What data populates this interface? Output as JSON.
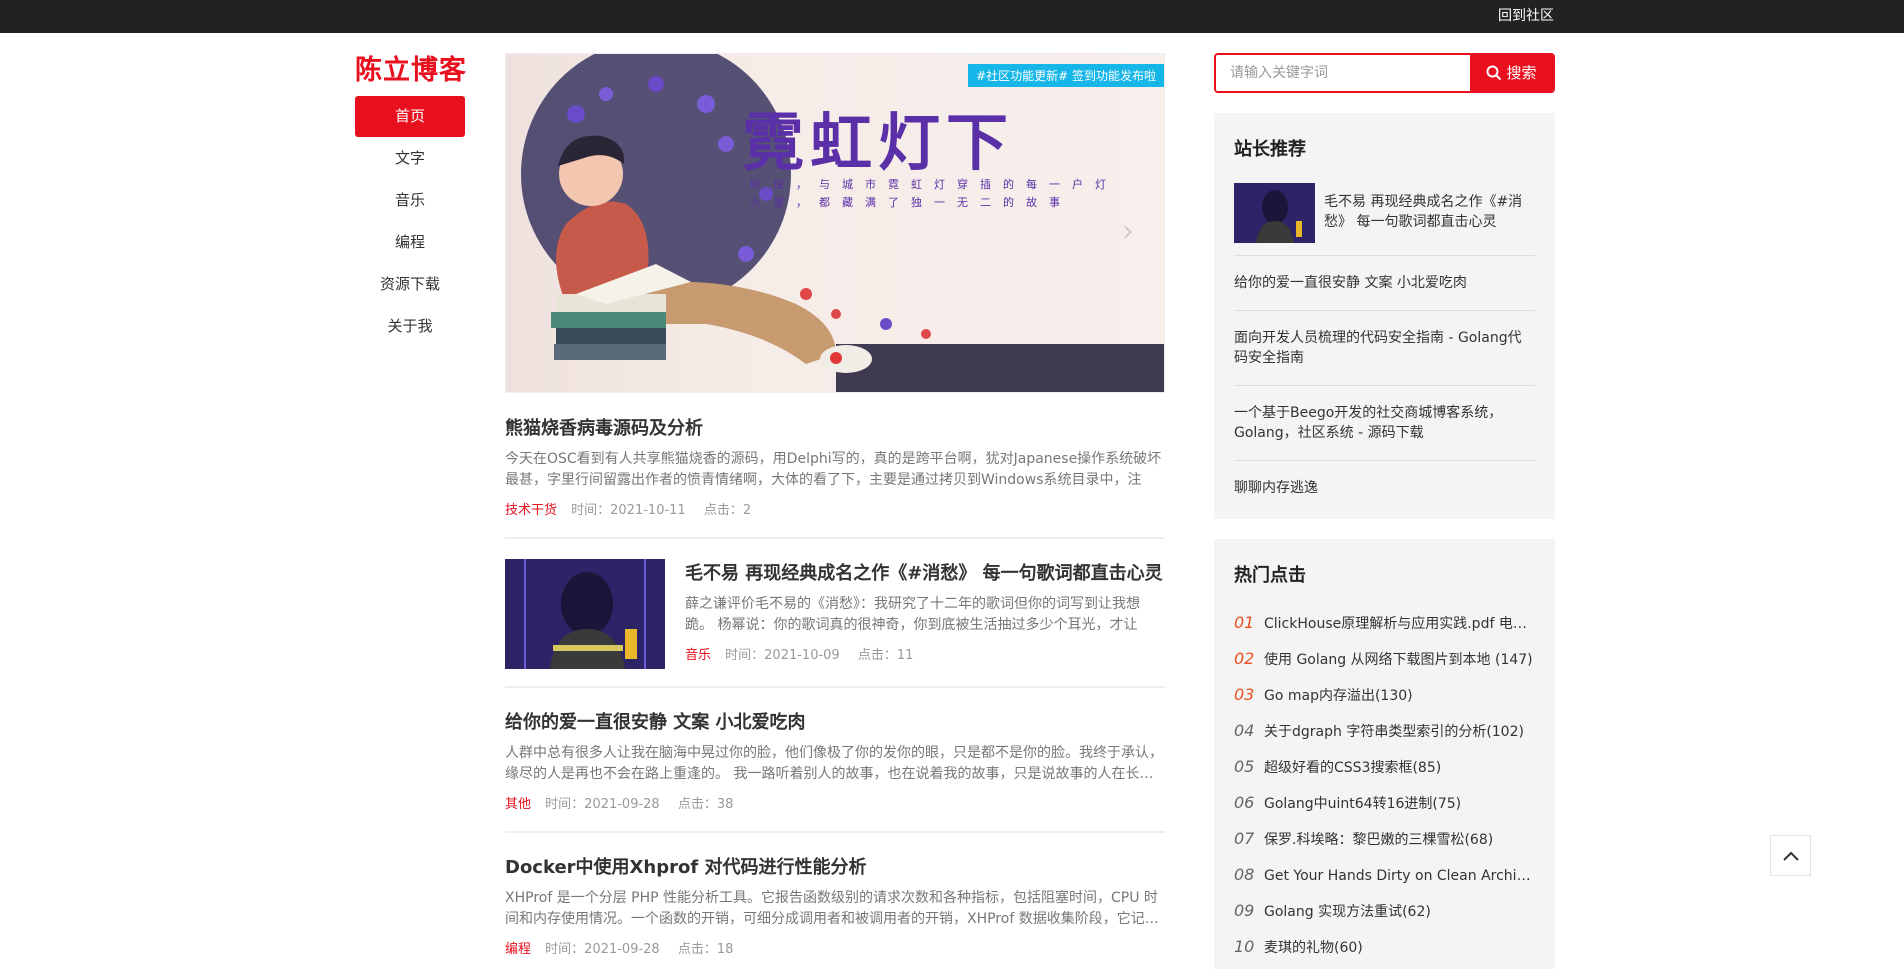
{
  "topbar": {
    "back_label": "回到社区"
  },
  "site": {
    "title": "陈立博客"
  },
  "nav": {
    "items": [
      {
        "label": "首页"
      },
      {
        "label": "文字"
      },
      {
        "label": "音乐"
      },
      {
        "label": "编程"
      },
      {
        "label": "资源下载"
      },
      {
        "label": "关于我"
      }
    ]
  },
  "banner": {
    "tag": "#社区功能更新# 签到功能发布啦",
    "title": "霓虹灯下",
    "subtitle": "听说，与城市霓虹灯穿插的每一户灯火里，都藏满了独一无二的故事"
  },
  "posts": [
    {
      "title": "熊猫烧香病毒源码及分析",
      "excerpt": "今天在OSC看到有人共享熊猫烧香的源码，用Delphi写的，真的是跨平台啊，犹对Japanese操作系统破坏最甚，字里行间留露出作者的愤青情绪啊，大体的看了下，主要是通过拷贝到Windows系统目录中，注册…",
      "category": "技术干货",
      "time": "时间：2021-10-11",
      "clicks": "点击：2"
    },
    {
      "title": "毛不易 再现经典成名之作《#消愁》 每一句歌词都直击心灵",
      "excerpt": "薛之谦评价毛不易的《消愁》：我研究了十二年的歌词但你的词写到让我想跪。 杨幂说：你的歌词真的很神奇，你到底被生活抽过多少个耳光，才让歌…",
      "category": "音乐",
      "time": "时间：2021-10-09",
      "clicks": "点击：11"
    },
    {
      "title": "给你的爱一直很安静 文案 小北爱吃肉",
      "excerpt": "人群中总有很多人让我在脑海中晃过你的脸，他们像极了你的发你的眼，只是都不是你的脸。我终于承认，缘尽的人是再也不会在路上重逢的。 我一路听着别人的故事，也在说着我的故事，只是说故事的人在长…",
      "category": "其他",
      "time": "时间：2021-09-28",
      "clicks": "点击：38"
    },
    {
      "title": "Docker中使用Xhprof 对代码进行性能分析",
      "excerpt": "XHProf 是一个分层 PHP 性能分析工具。它报告函数级别的请求次数和各种指标，包括阻塞时间，CPU 时间和内存使用情况。一个函数的开销，可细分成调用者和被调用者的开销，XHProf 数据收集阶段，它记…",
      "category": "编程",
      "time": "时间：2021-09-28",
      "clicks": "点击：18"
    }
  ],
  "search": {
    "placeholder": "请输入关键字词",
    "button_label": "搜索"
  },
  "recommend": {
    "title": "站长推荐",
    "items": [
      {
        "label": "毛不易 再现经典成名之作《#消愁》 每一句歌词都直击心灵"
      },
      {
        "label": "给你的爱一直很安静 文案 小北爱吃肉"
      },
      {
        "label": "面向开发人员梳理的代码安全指南 - Golang代码安全指南"
      },
      {
        "label": "一个基于Beego开发的社交商城博客系统，Golang，社区系统 - 源码下载"
      },
      {
        "label": "聊聊内存逃逸"
      }
    ]
  },
  "hot": {
    "title": "热门点击",
    "items": [
      {
        "num": "01",
        "label": "ClickHouse原理解析与应用实践.pdf 电子…"
      },
      {
        "num": "02",
        "label": "使用 Golang 从网络下载图片到本地 (147)"
      },
      {
        "num": "03",
        "label": "Go map内存溢出(130)"
      },
      {
        "num": "04",
        "label": "关于dgraph 字符串类型索引的分析(102)"
      },
      {
        "num": "05",
        "label": "超级好看的CSS3搜索框(85)"
      },
      {
        "num": "06",
        "label": "Golang中uint64转16进制(75)"
      },
      {
        "num": "07",
        "label": "保罗.科埃略：黎巴嫩的三棵雪松(68)"
      },
      {
        "num": "08",
        "label": "Get Your Hands Dirty on Clean Architect…"
      },
      {
        "num": "09",
        "label": "Golang 实现方法重试(62)"
      },
      {
        "num": "10",
        "label": "麦琪的礼物(60)"
      }
    ]
  },
  "colors": {
    "brand": "#e8101f",
    "topbar": "#222222",
    "tag": "#16b6e8",
    "panel": "#f4f4f5",
    "hot_top": "#e8501f"
  }
}
